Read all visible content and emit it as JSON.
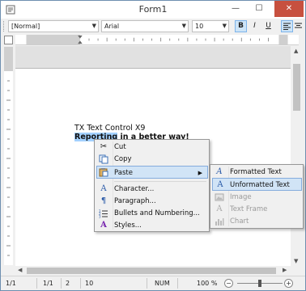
{
  "window": {
    "title": "Form1",
    "minimize": "—",
    "maximize": "☐",
    "close": "✕"
  },
  "toolbar": {
    "style_value": "[Normal]",
    "font_value": "Arial",
    "size_value": "10",
    "bold": "B",
    "italic": "I",
    "underline": "U"
  },
  "document": {
    "line1": "TX Text Control X9",
    "line2_selected": "Reporting",
    "line2_rest": " in a better way!"
  },
  "context_menu": {
    "items": [
      {
        "label": "Cut",
        "icon": "cut-icon"
      },
      {
        "label": "Copy",
        "icon": "copy-icon"
      },
      {
        "label": "Paste",
        "icon": "paste-icon"
      },
      {
        "label": "Character...",
        "icon": "character-icon"
      },
      {
        "label": "Paragraph...",
        "icon": "paragraph-icon"
      },
      {
        "label": "Bullets and Numbering...",
        "icon": "bullets-icon"
      },
      {
        "label": "Styles...",
        "icon": "styles-icon"
      }
    ]
  },
  "paste_submenu": {
    "items": [
      {
        "label": "Formatted Text",
        "icon": "formatted-text-icon",
        "enabled": true
      },
      {
        "label": "Unformatted Text",
        "icon": "unformatted-text-icon",
        "enabled": true
      },
      {
        "label": "Image",
        "icon": "image-icon",
        "enabled": false
      },
      {
        "label": "Text Frame",
        "icon": "text-frame-icon",
        "enabled": false
      },
      {
        "label": "Chart",
        "icon": "chart-icon",
        "enabled": false
      }
    ]
  },
  "statusbar": {
    "page": "1/1",
    "section": "1/1",
    "line": "2",
    "column": "10",
    "num": "NUM",
    "zoom": "100 %",
    "zoom_minus": "−",
    "zoom_plus": "+"
  },
  "colors": {
    "selection": "#3399ff",
    "menu_highlight": "#d1e4f6",
    "close_button": "#c7503f"
  }
}
